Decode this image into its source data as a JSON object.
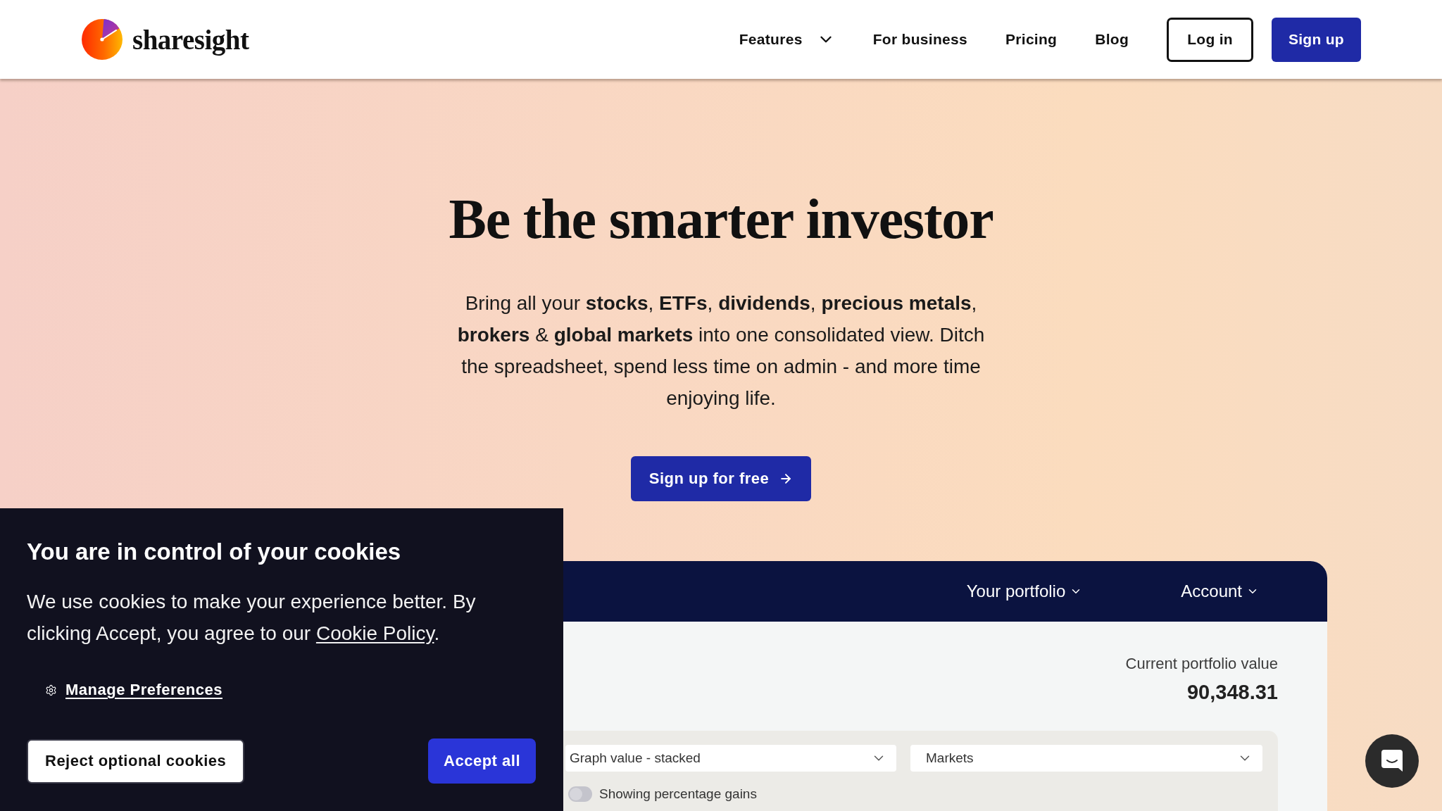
{
  "header": {
    "logo": {
      "text": "sharesight"
    },
    "nav": [
      {
        "label": "Features",
        "kind": "dropdown"
      },
      {
        "label": "For business",
        "kind": "link"
      },
      {
        "label": "Pricing",
        "kind": "link"
      },
      {
        "label": "Blog",
        "kind": "link"
      }
    ],
    "buttons": [
      {
        "label": "Log in",
        "kind": "outline"
      },
      {
        "label": "Sign up",
        "kind": "primary"
      }
    ]
  },
  "hero": {
    "title": "Be the smarter investor",
    "description": "Bring all your **stocks**, **ETFs**, **dividends**, **precious metals**, **brokers** & **global markets** into one consolidated view. Ditch the spreadsheet, spend less time on admin - and more time enjoying life.",
    "cta": "Sign up for free"
  },
  "app_preview": {
    "nav": [
      {
        "label": "Your portfolio"
      },
      {
        "label": "Account"
      }
    ],
    "value_label": "Current portfolio value",
    "value": "90,348.31",
    "selects": [
      {
        "value": "Graph value - stacked"
      },
      {
        "value": "Markets"
      }
    ],
    "toggle": {
      "label": "Showing percentage gains",
      "on": false
    }
  },
  "cookie_banner": {
    "title": "You are in control of your cookies",
    "text": "We use cookies to make your experience better. By clicking Accept, you agree to our",
    "link": "Cookie Policy",
    "text_end": ".",
    "manage_link": "Manage Preferences",
    "buttons": [
      {
        "label": "Reject optional cookies",
        "kind": "secondary"
      },
      {
        "label": "Accept all",
        "kind": "primary"
      }
    ]
  }
}
